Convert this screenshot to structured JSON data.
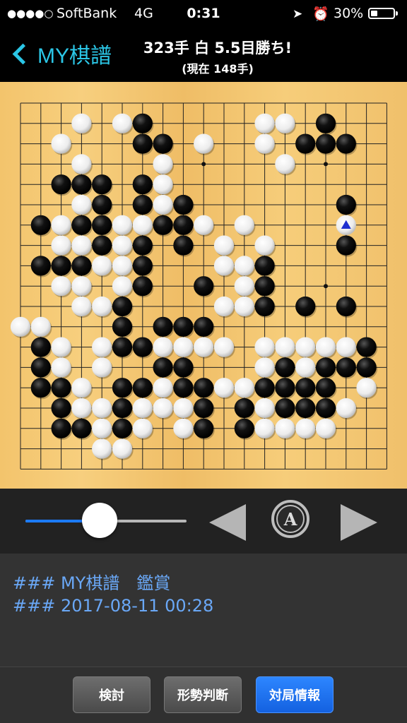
{
  "status_bar": {
    "signal_dots": "●●●●○",
    "carrier": "SoftBank",
    "network": "4G",
    "time": "0:31",
    "location_icon": "location-arrow-icon",
    "alarm_icon": "alarm-clock-icon",
    "battery_percent": "30%",
    "battery_level": 0.3
  },
  "nav": {
    "back_label": "MY棋譜",
    "title": "323手 白 5.5目勝ち!",
    "subtitle": "(現在 148手)"
  },
  "board": {
    "size": 19,
    "board_color": "#f3c46c",
    "last_move_marker_color": "#1f2fd0",
    "star_points": [
      [
        3,
        3
      ],
      [
        3,
        9
      ],
      [
        3,
        15
      ],
      [
        9,
        3
      ],
      [
        9,
        9
      ],
      [
        9,
        15
      ],
      [
        15,
        3
      ],
      [
        15,
        9
      ],
      [
        15,
        15
      ]
    ],
    "black_stones": [
      [
        6,
        1
      ],
      [
        15,
        1
      ],
      [
        6,
        2
      ],
      [
        7,
        2
      ],
      [
        14,
        2
      ],
      [
        15,
        2
      ],
      [
        16,
        2
      ],
      [
        2,
        4
      ],
      [
        3,
        4
      ],
      [
        4,
        4
      ],
      [
        6,
        4
      ],
      [
        4,
        5
      ],
      [
        6,
        5
      ],
      [
        8,
        5
      ],
      [
        16,
        5
      ],
      [
        1,
        6
      ],
      [
        3,
        6
      ],
      [
        4,
        6
      ],
      [
        7,
        6
      ],
      [
        8,
        6
      ],
      [
        4,
        7
      ],
      [
        6,
        7
      ],
      [
        8,
        7
      ],
      [
        16,
        7
      ],
      [
        1,
        8
      ],
      [
        2,
        8
      ],
      [
        3,
        8
      ],
      [
        6,
        8
      ],
      [
        12,
        8
      ],
      [
        6,
        9
      ],
      [
        9,
        9
      ],
      [
        12,
        9
      ],
      [
        5,
        10
      ],
      [
        12,
        10
      ],
      [
        14,
        10
      ],
      [
        16,
        10
      ],
      [
        5,
        11
      ],
      [
        7,
        11
      ],
      [
        8,
        11
      ],
      [
        9,
        11
      ],
      [
        1,
        12
      ],
      [
        5,
        12
      ],
      [
        6,
        12
      ],
      [
        17,
        12
      ],
      [
        1,
        13
      ],
      [
        7,
        13
      ],
      [
        8,
        13
      ],
      [
        13,
        13
      ],
      [
        15,
        13
      ],
      [
        16,
        13
      ],
      [
        17,
        13
      ],
      [
        1,
        14
      ],
      [
        2,
        14
      ],
      [
        5,
        14
      ],
      [
        6,
        14
      ],
      [
        8,
        14
      ],
      [
        9,
        14
      ],
      [
        12,
        14
      ],
      [
        13,
        14
      ],
      [
        14,
        14
      ],
      [
        15,
        14
      ],
      [
        2,
        15
      ],
      [
        5,
        15
      ],
      [
        9,
        15
      ],
      [
        11,
        15
      ],
      [
        13,
        15
      ],
      [
        14,
        15
      ],
      [
        15,
        15
      ],
      [
        2,
        16
      ],
      [
        3,
        16
      ],
      [
        5,
        16
      ],
      [
        9,
        16
      ],
      [
        11,
        16
      ]
    ],
    "white_stones": [
      [
        3,
        1
      ],
      [
        5,
        1
      ],
      [
        12,
        1
      ],
      [
        13,
        1
      ],
      [
        2,
        2
      ],
      [
        9,
        2
      ],
      [
        12,
        2
      ],
      [
        3,
        3
      ],
      [
        7,
        3
      ],
      [
        13,
        3
      ],
      [
        7,
        4
      ],
      [
        3,
        5
      ],
      [
        7,
        5
      ],
      [
        2,
        6
      ],
      [
        5,
        6
      ],
      [
        6,
        6
      ],
      [
        9,
        6
      ],
      [
        11,
        6
      ],
      [
        2,
        7
      ],
      [
        3,
        7
      ],
      [
        5,
        7
      ],
      [
        10,
        7
      ],
      [
        12,
        7
      ],
      [
        4,
        8
      ],
      [
        5,
        8
      ],
      [
        10,
        8
      ],
      [
        11,
        8
      ],
      [
        2,
        9
      ],
      [
        3,
        9
      ],
      [
        5,
        9
      ],
      [
        11,
        9
      ],
      [
        3,
        10
      ],
      [
        4,
        10
      ],
      [
        10,
        10
      ],
      [
        11,
        10
      ],
      [
        0,
        11
      ],
      [
        1,
        11
      ],
      [
        2,
        12
      ],
      [
        4,
        12
      ],
      [
        7,
        12
      ],
      [
        8,
        12
      ],
      [
        9,
        12
      ],
      [
        10,
        12
      ],
      [
        12,
        12
      ],
      [
        13,
        12
      ],
      [
        14,
        12
      ],
      [
        15,
        12
      ],
      [
        16,
        12
      ],
      [
        2,
        13
      ],
      [
        4,
        13
      ],
      [
        12,
        13
      ],
      [
        14,
        13
      ],
      [
        3,
        14
      ],
      [
        7,
        14
      ],
      [
        10,
        14
      ],
      [
        11,
        14
      ],
      [
        17,
        14
      ],
      [
        3,
        15
      ],
      [
        4,
        15
      ],
      [
        6,
        15
      ],
      [
        7,
        15
      ],
      [
        8,
        15
      ],
      [
        12,
        15
      ],
      [
        16,
        15
      ],
      [
        4,
        16
      ],
      [
        6,
        16
      ],
      [
        8,
        16
      ],
      [
        12,
        16
      ],
      [
        13,
        16
      ],
      [
        14,
        16
      ],
      [
        15,
        16
      ],
      [
        4,
        17
      ],
      [
        5,
        17
      ]
    ],
    "last_move": [
      16,
      6
    ]
  },
  "controls": {
    "slider_value": 0.46,
    "prev_icon": "triangle-left-icon",
    "auto_label": "A",
    "next_icon": "triangle-right-icon"
  },
  "comments": {
    "line1": "### MY棋譜　鑑賞",
    "line2": "### 2017-08-11 00:28"
  },
  "toolbar": {
    "review_label": "検討",
    "evaluate_label": "形勢判断",
    "info_label": "対局情報"
  }
}
